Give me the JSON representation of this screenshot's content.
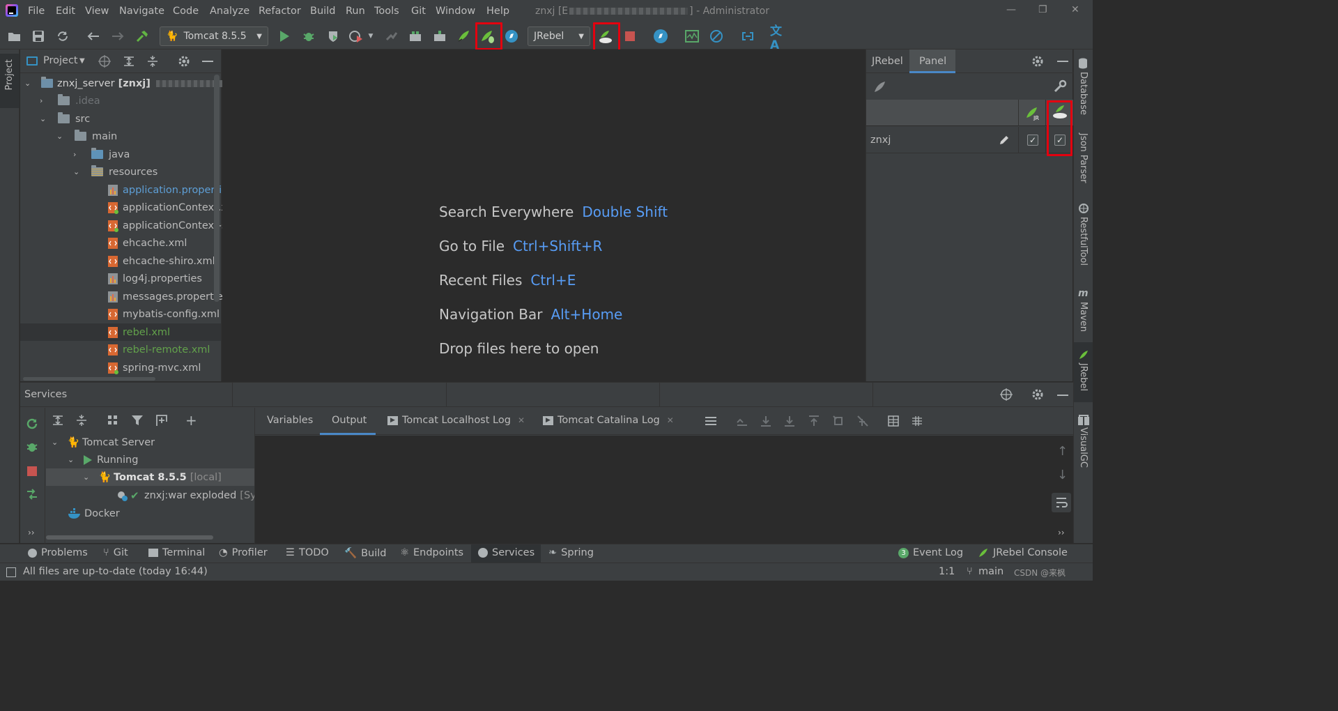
{
  "window": {
    "title": "znxj [E",
    "title_suffix": "] - Administrator",
    "menu": [
      "File",
      "Edit",
      "View",
      "Navigate",
      "Code",
      "Analyze",
      "Refactor",
      "Build",
      "Run",
      "Tools",
      "Git",
      "Window",
      "Help"
    ]
  },
  "toolbar": {
    "run_config": "Tomcat 8.5.5",
    "jrebel_combo": "JRebel"
  },
  "left_strip": {
    "project_label": "Project"
  },
  "right_strip": {
    "database": "Database",
    "json_parser": "Json Parser",
    "restful_tool": "RestfulTool",
    "maven": "Maven",
    "jrebel": "JRebel",
    "visualgc": "VisualGC"
  },
  "project": {
    "title": "Project",
    "root": "znxj_server",
    "root_bold": "[znxj]",
    "items": [
      {
        "label": ".idea",
        "kind": "folder"
      },
      {
        "label": "src",
        "kind": "folder"
      },
      {
        "label": "main",
        "kind": "folder"
      },
      {
        "label": "java",
        "kind": "folder"
      },
      {
        "label": "resources",
        "kind": "folder"
      },
      {
        "label": "application.propertie",
        "kind": "props"
      },
      {
        "label": "applicationContext.xr",
        "kind": "xml"
      },
      {
        "label": "applicationContext-sl",
        "kind": "xml"
      },
      {
        "label": "ehcache.xml",
        "kind": "xml"
      },
      {
        "label": "ehcache-shiro.xml",
        "kind": "xml"
      },
      {
        "label": "log4j.properties",
        "kind": "props"
      },
      {
        "label": "messages.properties",
        "kind": "props"
      },
      {
        "label": "mybatis-config.xml",
        "kind": "xml"
      },
      {
        "label": "rebel.xml",
        "kind": "xml"
      },
      {
        "label": "rebel-remote.xml",
        "kind": "xml"
      },
      {
        "label": "spring-mvc.xml",
        "kind": "xml"
      }
    ]
  },
  "editor": {
    "hints": [
      {
        "text": "Search Everywhere",
        "key": "Double Shift"
      },
      {
        "text": "Go to File",
        "key": "Ctrl+Shift+R"
      },
      {
        "text": "Recent Files",
        "key": "Ctrl+E"
      },
      {
        "text": "Navigation Bar",
        "key": "Alt+Home"
      },
      {
        "text": "Drop files here to open",
        "key": ""
      }
    ]
  },
  "jrebel_panel": {
    "tab_jrebel": "JRebel",
    "tab_panel": "Panel",
    "module": "znxj",
    "jrebel_checked": true,
    "remote_checked": true
  },
  "services": {
    "title": "Services",
    "tree": {
      "server": "Tomcat Server",
      "running": "Running",
      "tomcat": "Tomcat 8.5.5",
      "tomcat_suffix": "[local]",
      "artifact": "znxj:war exploded",
      "artifact_suffix": "[Syn",
      "docker": "Docker"
    },
    "tabs": {
      "variables": "Variables",
      "output": "Output",
      "localhost_log": "Tomcat Localhost Log",
      "catalina_log": "Tomcat Catalina Log"
    }
  },
  "bottom_tabs": {
    "problems": "Problems",
    "git": "Git",
    "terminal": "Terminal",
    "profiler": "Profiler",
    "todo": "TODO",
    "build": "Build",
    "endpoints": "Endpoints",
    "services": "Services",
    "spring": "Spring",
    "event_log_count": "3",
    "event_log": "Event Log",
    "jrebel_console": "JRebel Console"
  },
  "status": {
    "message": "All files are up-to-date (today 16:44)",
    "position": "1:1",
    "branch": "main",
    "watermark": "CSDN @来枫"
  },
  "colors": {
    "background": "#2b2b2b",
    "panel": "#3c3f41",
    "accent_link": "#589df6",
    "jrebel_green": "#6abf3b",
    "highlight_red": "#e3000f"
  }
}
